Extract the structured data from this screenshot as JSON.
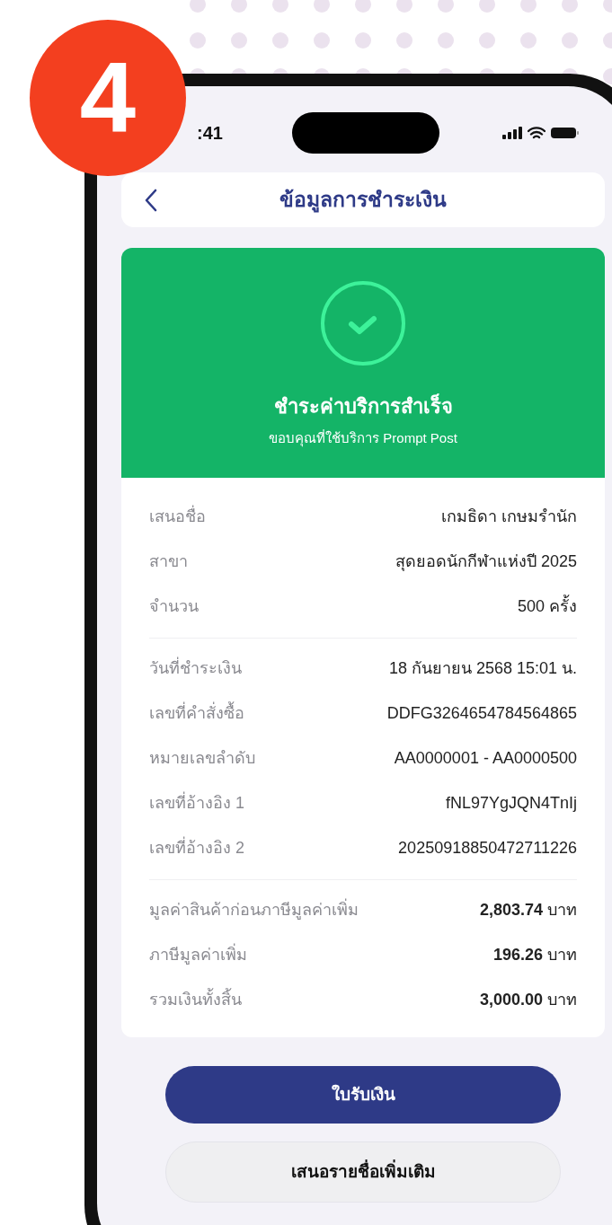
{
  "badge": {
    "number": "4"
  },
  "status_bar": {
    "time": ":41"
  },
  "header": {
    "title": "ข้อมูลการชำระเงิน"
  },
  "success": {
    "title": "ชำระค่าบริการสำเร็จ",
    "subtitle": "ขอบคุณที่ใช้บริการ Prompt Post"
  },
  "sections": [
    {
      "rows": [
        {
          "label": "เสนอชื่อ",
          "value": "เกมธิดา เกษมรำนัก"
        },
        {
          "label": "สาขา",
          "value": "สุดยอดนักกีฬาแห่งปี 2025"
        },
        {
          "label": "จำนวน",
          "value": "500 ครั้ง"
        }
      ]
    },
    {
      "rows": [
        {
          "label": "วันที่ชำระเงิน",
          "value": "18 กันยายน 2568  15:01 น."
        },
        {
          "label": "เลขที่คำสั่งซื้อ",
          "value": "DDFG3264654784564865"
        },
        {
          "label": "หมายเลขลำดับ",
          "value": "AA0000001 - AA0000500"
        },
        {
          "label": "เลขที่อ้างอิง 1",
          "value": "fNL97YgJQN4TnIj"
        },
        {
          "label": "เลขที่อ้างอิง 2",
          "value": "20250918850472711226"
        }
      ]
    },
    {
      "rows": [
        {
          "label": "มูลค่าสินค้าก่อนภาษีมูลค่าเพิ่ม",
          "value": "**2,803.74** บาท"
        },
        {
          "label": "ภาษีมูลค่าเพิ่ม",
          "value": "**196.26** บาท"
        },
        {
          "label": "รวมเงินทั้งสิ้น",
          "value": "**3,000.00** บาท"
        }
      ]
    }
  ],
  "buttons": [
    {
      "label": "ใบรับเงิน",
      "kind": "primary"
    },
    {
      "label": "เสนอรายชื่อเพิ่มเติม",
      "kind": "secondary"
    }
  ]
}
